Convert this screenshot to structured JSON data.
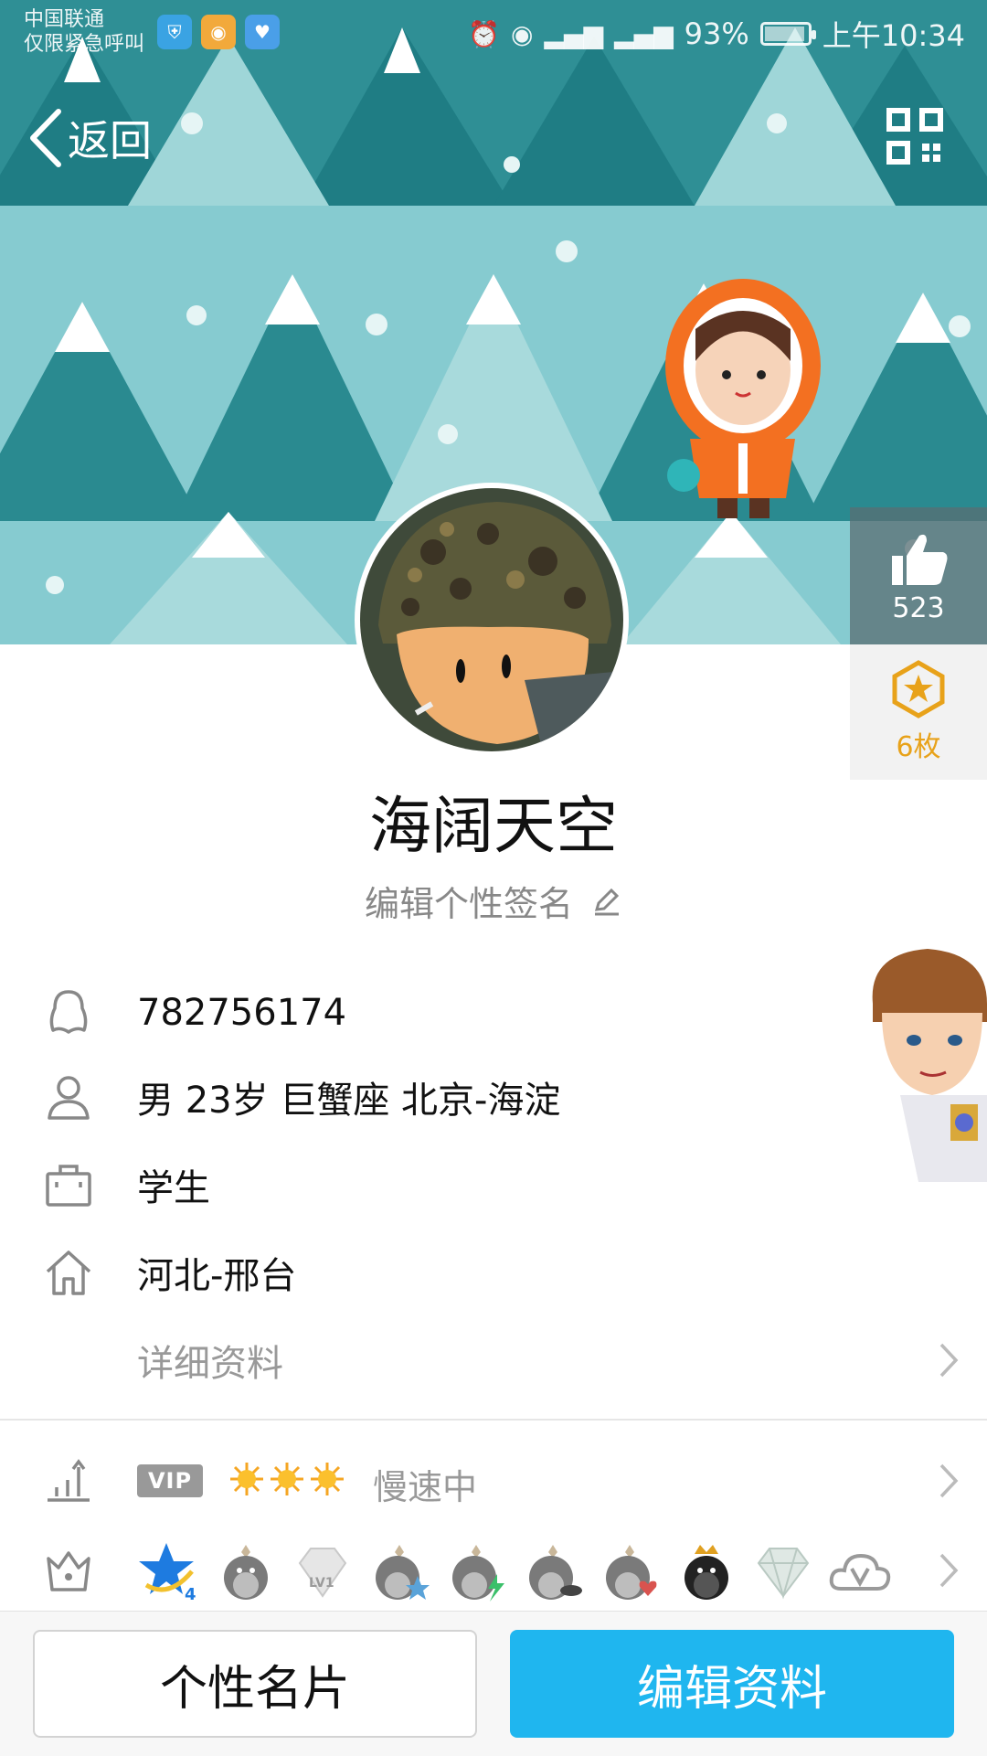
{
  "status_bar": {
    "carrier_line1": "中国联通",
    "carrier_line2": "仅限紧急呼叫",
    "battery": "93%",
    "time": "上午10:34",
    "battery_level": 0.93
  },
  "nav": {
    "back_label": "返回"
  },
  "side_panel": {
    "like_count": "523",
    "medal_count": "6枚"
  },
  "profile": {
    "name": "海阔天空",
    "signature": "编辑个性签名",
    "qq_number": "782756174",
    "basic_info": "男  23岁  巨蟹座  北京-海淀",
    "occupation": "学生",
    "hometown": "河北-邢台",
    "details_label": "详细资料"
  },
  "vip": {
    "tag": "VIP",
    "status": "慢速中"
  },
  "badges": {
    "level_badge_number": "4",
    "lv_label": "LV1"
  },
  "buttons": {
    "card": "个性名片",
    "edit": "编辑资料"
  },
  "colors": {
    "accent": "#1fb6ef",
    "banner": "#86cbd0",
    "medal": "#e8a21a"
  }
}
